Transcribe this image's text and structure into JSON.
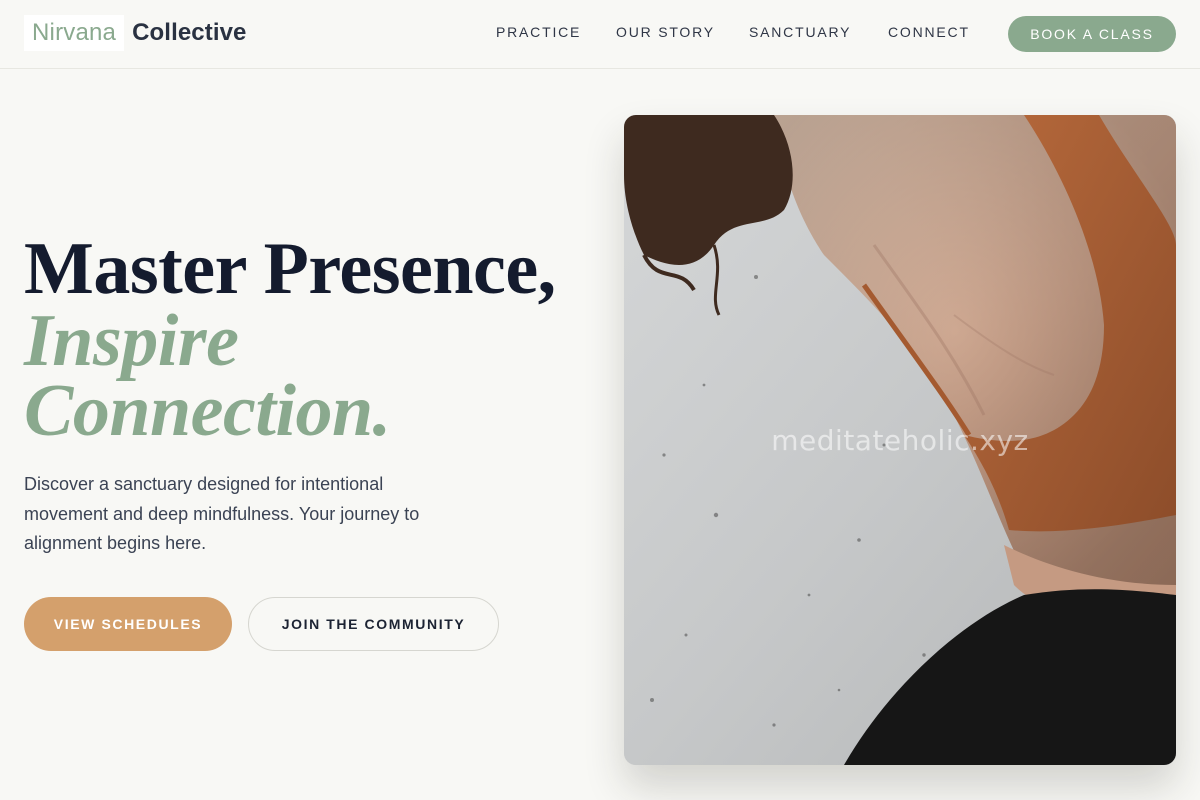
{
  "brand": {
    "primary": "Nirvana",
    "secondary": "Collective",
    "accent_color": "#8aa98e"
  },
  "nav": {
    "items": [
      {
        "label": "PRACTICE"
      },
      {
        "label": "OUR STORY"
      },
      {
        "label": "SANCTUARY"
      },
      {
        "label": "CONNECT"
      }
    ],
    "cta_label": "BOOK A CLASS"
  },
  "hero": {
    "headline_line1": "Master Presence,",
    "headline_line2": "Inspire",
    "headline_line3": "Connection.",
    "intro": "Discover a sanctuary designed for intentional movement and deep mindfulness. Your journey to alignment begins here.",
    "primary_button": "VIEW SCHEDULES",
    "secondary_button": "JOIN THE COMMUNITY",
    "primary_button_color": "#d4a06c",
    "image_watermark": "meditateholic.xyz"
  }
}
